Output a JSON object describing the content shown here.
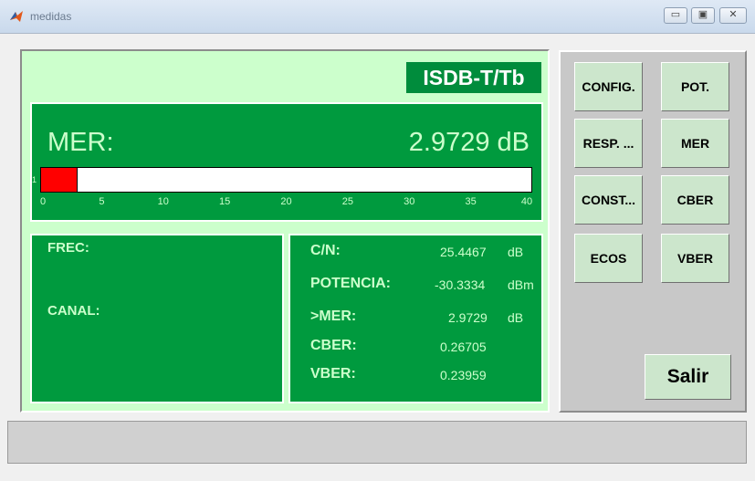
{
  "window": {
    "title": "medidas",
    "controls": {
      "minimize": "▭",
      "maximize": "▣",
      "close": "✕"
    }
  },
  "standard": "ISDB-T/Tb",
  "mer": {
    "label": "MER:",
    "value": "2.9729 dB",
    "bar_level": 2.9729,
    "bar_min": 0,
    "bar_max": 40,
    "bar_marker": "1",
    "ticks": [
      "0",
      "5",
      "10",
      "15",
      "20",
      "25",
      "30",
      "35",
      "40"
    ],
    "bar_color": "#ff0000"
  },
  "left_info": {
    "frec_label": "FREC:",
    "canal_label": "CANAL:"
  },
  "measurements": [
    {
      "label": "C/N:",
      "value": "25.4467",
      "unit": "dB"
    },
    {
      "label": "POTENCIA:",
      "value": "-30.3334",
      "unit": "dBm"
    },
    {
      "label": ">MER:",
      "value": "2.9729",
      "unit": "dB"
    },
    {
      "label": "CBER:",
      "value": "0.26705",
      "unit": ""
    },
    {
      "label": "VBER:",
      "value": "0.23959",
      "unit": ""
    }
  ],
  "buttons": {
    "config": "CONFIG.",
    "pot": "POT.",
    "resp": "RESP. ...",
    "mer": "MER",
    "const": "CONST...",
    "cber": "CBER",
    "ecos": "ECOS",
    "vber": "VBER",
    "salir": "Salir"
  },
  "colors": {
    "panel_green": "#009a3e",
    "light_green": "#ccffcc",
    "button_green": "#cce6cc"
  }
}
